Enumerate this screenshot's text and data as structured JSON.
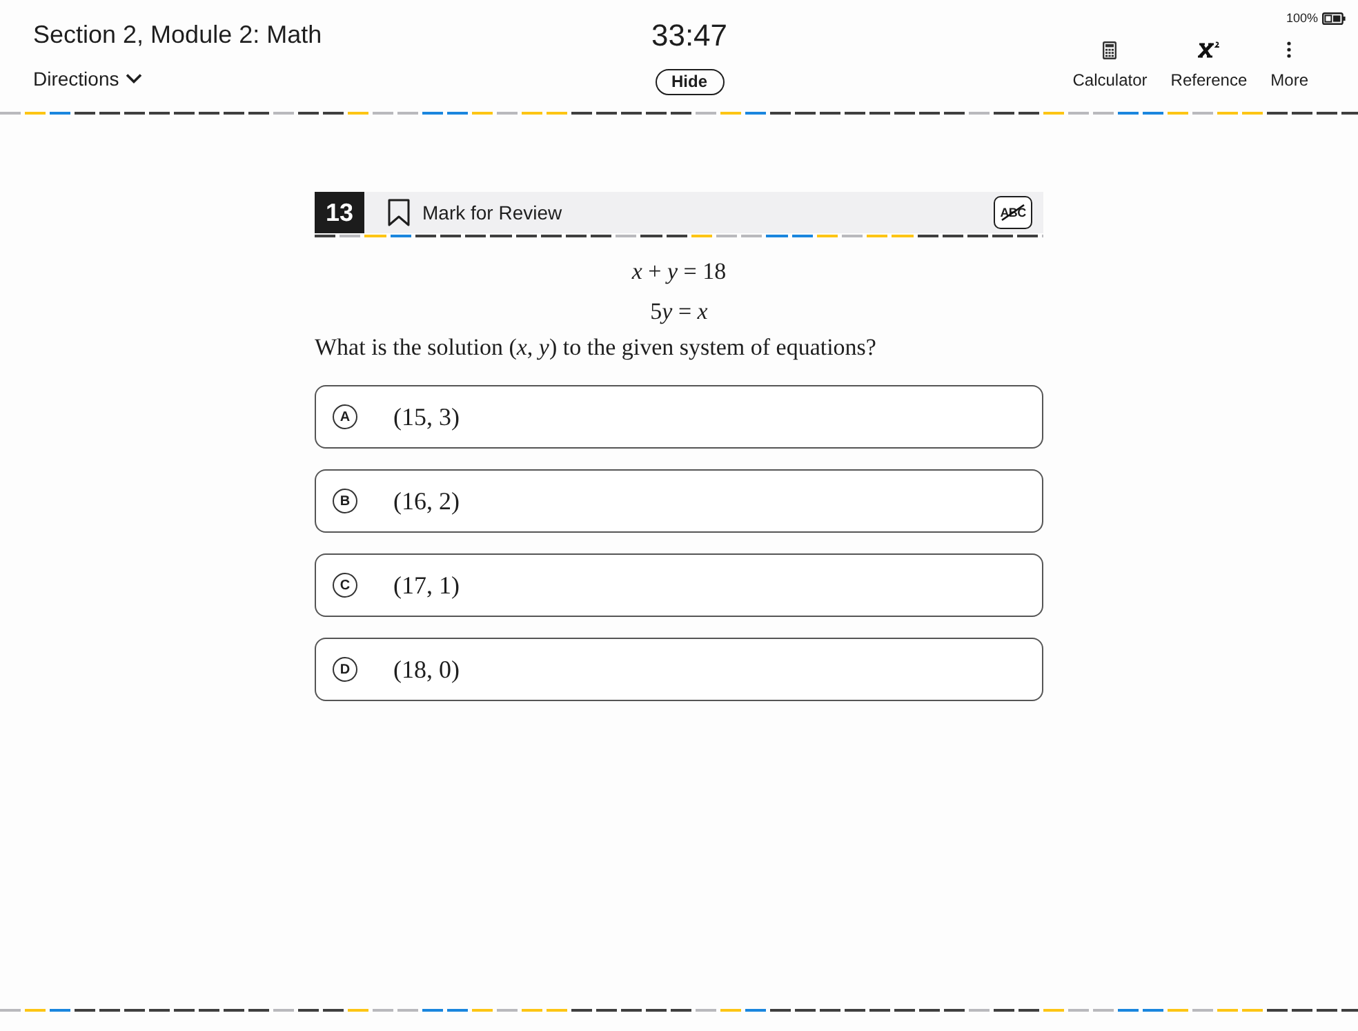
{
  "header": {
    "title": "Section 2, Module 2: Math",
    "directions": {
      "label": "Directions",
      "expanded": false
    },
    "timer": "33:47",
    "hide_button": "Hide",
    "battery": "100%",
    "tools": [
      {
        "kind": "calculator",
        "label": "Calculator"
      },
      {
        "kind": "reference",
        "label": "Reference"
      },
      {
        "kind": "more",
        "label": "More"
      }
    ]
  },
  "question": {
    "number": "13",
    "mark_for_review": {
      "label": "Mark for Review",
      "marked": false
    },
    "eliminator": {
      "label": "ABC",
      "on": false
    },
    "equations": [
      [
        "*x* + *y* = 18"
      ],
      [
        "5",
        "*y* = *x*"
      ]
    ],
    "prompt": "What is the solution (*x*, *y*) to the given system of equations?",
    "choices": [
      {
        "letter": "A",
        "text": "(15, 3)",
        "selected": false
      },
      {
        "letter": "B",
        "text": "(16, 2)",
        "selected": false
      },
      {
        "letter": "C",
        "text": "(17, 1)",
        "selected": false
      },
      {
        "letter": "D",
        "text": "(18, 0)",
        "selected": false
      }
    ]
  }
}
